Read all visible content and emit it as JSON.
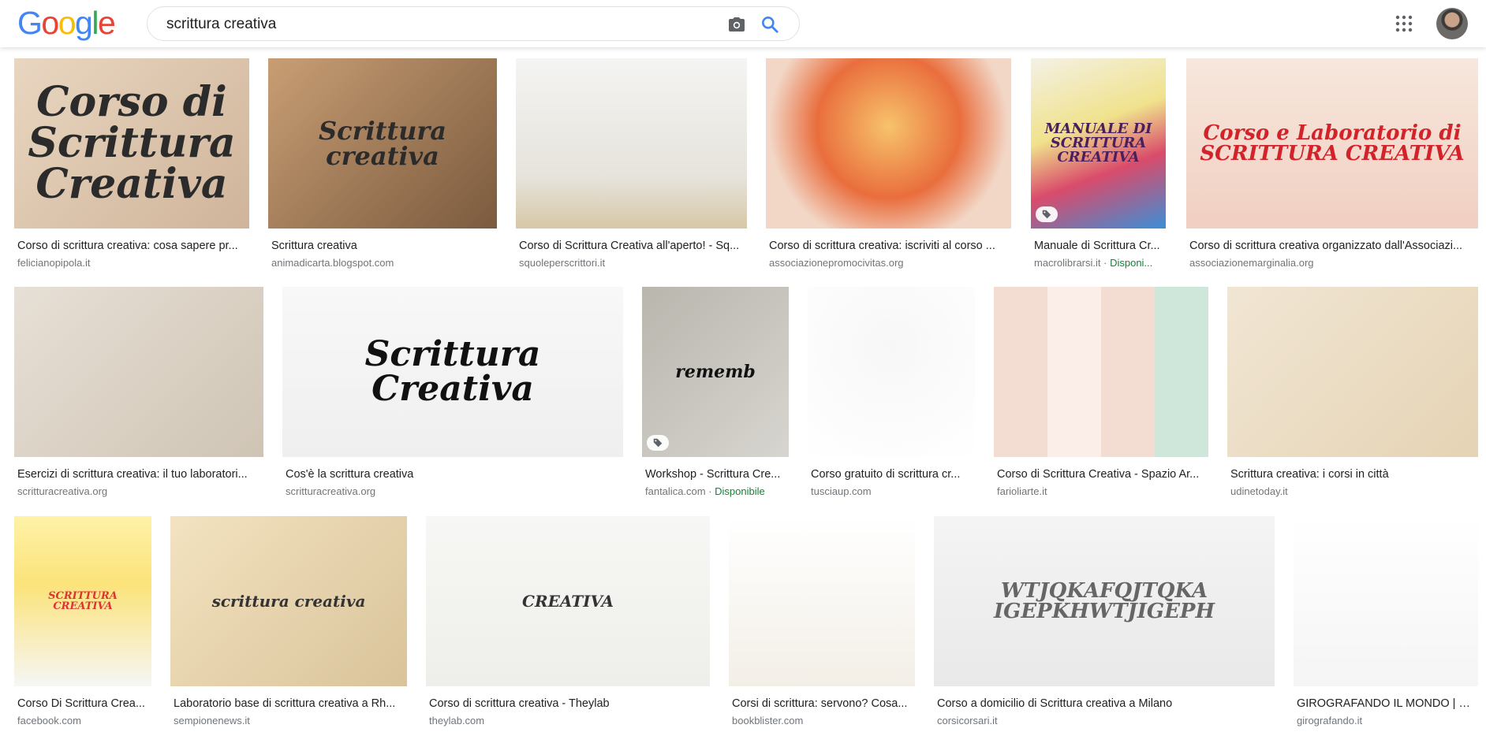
{
  "header": {
    "logo_letters": [
      {
        "ch": "G",
        "color": "#4285f4"
      },
      {
        "ch": "o",
        "color": "#ea4335"
      },
      {
        "ch": "o",
        "color": "#fbbc05"
      },
      {
        "ch": "g",
        "color": "#4285f4"
      },
      {
        "ch": "l",
        "color": "#34a853"
      },
      {
        "ch": "e",
        "color": "#ea4335"
      }
    ],
    "search_query": "scrittura creativa",
    "camera_icon": "camera-icon",
    "search_icon": "search-icon",
    "apps_icon": "apps-grid-icon",
    "avatar_icon": "user-avatar"
  },
  "results": [
    {
      "title": "Corso di scrittura creativa: cosa sapere pr...",
      "domain": "felicianopipola.it",
      "image_text": "Corso di Scrittura Creativa"
    },
    {
      "title": "Scrittura creativa",
      "domain": "animadicarta.blogspot.com",
      "image_text": "Scrittura creativa"
    },
    {
      "title": "Corso di Scrittura Creativa all'aperto! - Sq...",
      "domain": "squoleperscrittori.it",
      "image_text": ""
    },
    {
      "title": "Corso di scrittura creativa: iscriviti al corso ...",
      "domain": "associazionepromocivitas.org",
      "image_text": ""
    },
    {
      "title": "Manuale di Scrittura Cr...",
      "domain": "macrolibrarsi.it",
      "availability": "Disponi...",
      "image_text": "MANUALE DI SCRITTURA CREATIVA"
    },
    {
      "title": "Corso di scrittura creativa organizzato dall'Associazi...",
      "domain": "associazionemarginalia.org",
      "image_text": "Corso e Laboratorio di SCRITTURA CREATIVA"
    },
    {
      "title": "Esercizi di scrittura creativa: il tuo laboratori...",
      "domain": "scritturacreativa.org",
      "image_text": ""
    },
    {
      "title": "Cos'è la scrittura creativa",
      "domain": "scritturacreativa.org",
      "image_text": "Scrittura Creativa"
    },
    {
      "title": "Workshop - Scrittura Cre...",
      "domain": "fantalica.com",
      "availability": "Disponibile",
      "image_text": "rememb"
    },
    {
      "title": "Corso gratuito di scrittura cr...",
      "domain": "tusciaup.com",
      "image_text": ""
    },
    {
      "title": "Corso di Scrittura Creativa - Spazio Ar...",
      "domain": "farioliarte.it",
      "image_text": ""
    },
    {
      "title": "Scrittura creativa: i corsi in città",
      "domain": "udinetoday.it",
      "image_text": ""
    },
    {
      "title": "Corso Di Scrittura Crea...",
      "domain": "facebook.com",
      "image_text": "SCRITTURA CREATIVA"
    },
    {
      "title": "Laboratorio base di scrittura creativa a Rh...",
      "domain": "sempionenews.it",
      "image_text": "scrittura creativa"
    },
    {
      "title": "Corso di scrittura creativa - Theylab",
      "domain": "theylab.com",
      "image_text": "CREATIVA"
    },
    {
      "title": "Corsi di scrittura: servono? Cosa...",
      "domain": "bookblister.com",
      "image_text": ""
    },
    {
      "title": "Corso a domicilio di Scrittura creativa a Milano",
      "domain": "corsicorsari.it",
      "image_text": "WTJQKAFQJTQKA IGEPKHWTJIGEPH"
    },
    {
      "title": "GIROGRAFANDO IL MONDO | Pr...",
      "domain": "girografando.it",
      "image_text": ""
    }
  ],
  "colors": {
    "caption_title": "#202124",
    "caption_domain": "#70757a",
    "available": "#188038",
    "search_blue": "#4285f4"
  }
}
